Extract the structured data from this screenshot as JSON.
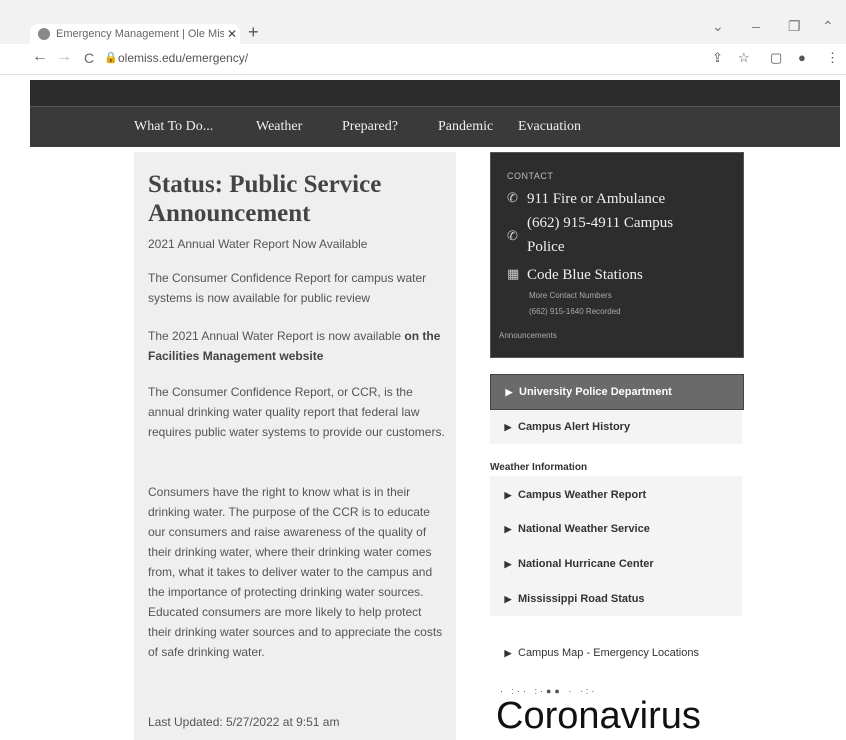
{
  "browser": {
    "tab_title": "Emergency Management | Ole Miss",
    "tab_close": "✕",
    "new_tab": "+",
    "url": "olemiss.edu/emergency/",
    "back": "←",
    "forward": "→",
    "reload": "C"
  },
  "nav": {
    "items": [
      "What To Do...",
      "Weather",
      "Prepared?",
      "Pandemic",
      "Evacuation"
    ]
  },
  "main": {
    "title": "Status: Public Service Announcement",
    "p1": "2021 Annual Water Report Now Available",
    "p2": "The Consumer Confidence Report for campus water systems is now available for public review",
    "p3_prefix": "The 2021 Annual Water Report is now available ",
    "p3_link": "on the Facilities Management website",
    "p4": "The Consumer Confidence Report, or CCR, is the annual drinking water quality report that federal law requires public water systems to provide our customers.",
    "p5": "Consumers have the right to know what is in their drinking water. The purpose of the CCR is to educate our consumers and raise awareness of the quality of their drinking water, where their drinking water comes from, what it takes to deliver water to the campus and the importance of protecting drinking water sources. Educated consumers are more likely to help protect their drinking water sources and to appreciate the costs of safe drinking water.",
    "updated": "Last Updated: 5/27/2022 at 9:51 am"
  },
  "contact": {
    "label": "CONTACT",
    "fire": "911 Fire or Ambulance",
    "police_num": "(662) 915-4911 Campus",
    "police_word": "Police",
    "blue": "Code Blue Stations",
    "more": "More Contact Numbers",
    "recorded": "(662) 915-1640 Recorded",
    "announcements": "Announcements"
  },
  "links": {
    "upd": "University Police Department",
    "alert": "Campus Alert History",
    "weather_label": "Weather Information",
    "weather": [
      "Campus Weather Report",
      "National Weather Service",
      "National Hurricane Center",
      "Mississippi Road Status"
    ],
    "map": "Campus Map - Emergency Locations"
  },
  "banner": {
    "corona": "Coronavirus"
  }
}
